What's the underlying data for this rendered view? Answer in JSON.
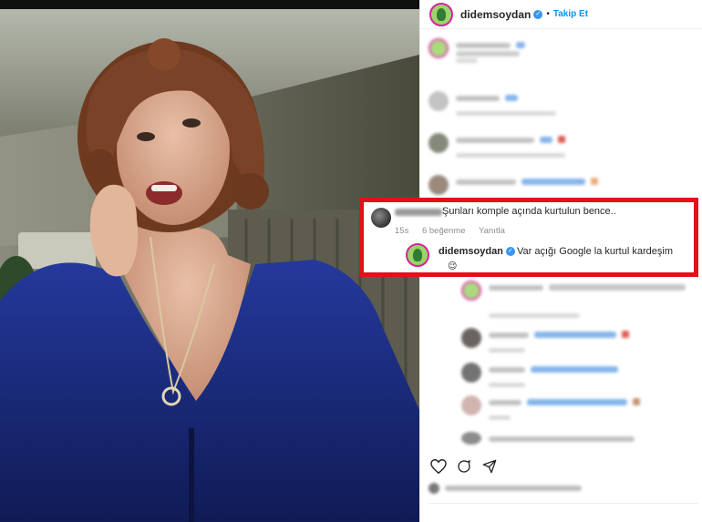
{
  "post_header": {
    "username": "didemsoydan",
    "separator": "•",
    "follow_label": "Takip Et"
  },
  "highlighted_comments": {
    "first": {
      "text": "Şunları komple açında kurtulun bence..",
      "time": "15s",
      "likes": "6 beğenme",
      "reply_label": "Yanıtla"
    },
    "reply": {
      "username": "didemsoydan",
      "text": "Var açığı Google la kurtul kardeşim",
      "emoji": "😉"
    }
  },
  "icons": {
    "verified": "verified-badge-icon",
    "like": "heart-icon",
    "comment": "comment-icon",
    "share": "share-icon"
  },
  "colors": {
    "highlight_border": "#e3101a",
    "follow_blue": "#0095f6",
    "verified_blue": "#3897f0",
    "dress_blue": "#1c2f86"
  }
}
